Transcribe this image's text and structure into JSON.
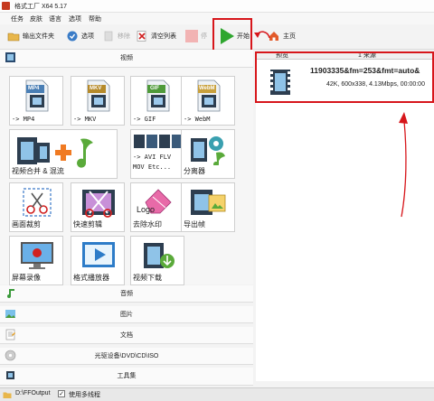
{
  "window": {
    "title": "格式工厂 X64 5.17"
  },
  "menu": [
    "任务",
    "皮肤",
    "语言",
    "选项",
    "帮助"
  ],
  "toolbar": {
    "output_folder": "输出文件夹",
    "options": "选项",
    "remove": "移除",
    "clear_list": "清空列表",
    "stop": "停",
    "start": "开始",
    "home": "主页"
  },
  "categories": {
    "video": "视频",
    "audio": "音频",
    "picture": "图片",
    "document": "文档",
    "disc": "光驱设备\\DVD\\CD\\ISO",
    "tools": "工具集"
  },
  "tiles": [
    {
      "label": "-> MP4",
      "badge": "MP4",
      "icon": "film-doc-icon"
    },
    {
      "label": "-> MKV",
      "badge": "MKV",
      "icon": "film-doc-icon"
    },
    {
      "label": "-> GIF",
      "badge": "GIF",
      "icon": "film-doc-icon"
    },
    {
      "label": "-> WebM",
      "badge": "WebM",
      "icon": "film-doc-icon"
    },
    {
      "label": "视频合并 & 混流",
      "icon": "merge-icon"
    },
    {
      "label": "-> AVI FLV",
      "label2": "MOV Etc...",
      "icon": "multi-format-icon"
    },
    {
      "label": "分离器",
      "icon": "splitter-icon"
    },
    {
      "label": "画面裁剪",
      "icon": "crop-icon"
    },
    {
      "label": "快速剪辑",
      "icon": "scissors-icon"
    },
    {
      "label": "去除水印",
      "icon": "eraser-icon",
      "logo_text": "Logo"
    },
    {
      "label": "导出帧",
      "icon": "export-frame-icon"
    },
    {
      "label": "屏幕录像",
      "icon": "screen-record-icon"
    },
    {
      "label": "格式播放器",
      "icon": "player-icon"
    },
    {
      "label": "视频下载",
      "icon": "download-icon"
    }
  ],
  "task_list": {
    "headers": {
      "preview": "预览",
      "source": "1 来源"
    },
    "items": [
      {
        "filename": "11903335&fm=253&fmt=auto&",
        "details": "42K, 600x338, 4.13Mbps, 00:00:00"
      }
    ]
  },
  "status": {
    "output_path": "D:\\FFOutput",
    "multithread_label": "使用多线程",
    "multithread_checked": true
  },
  "colors": {
    "annotation_red": "#d7161b",
    "start_green": "#2fa62f"
  }
}
